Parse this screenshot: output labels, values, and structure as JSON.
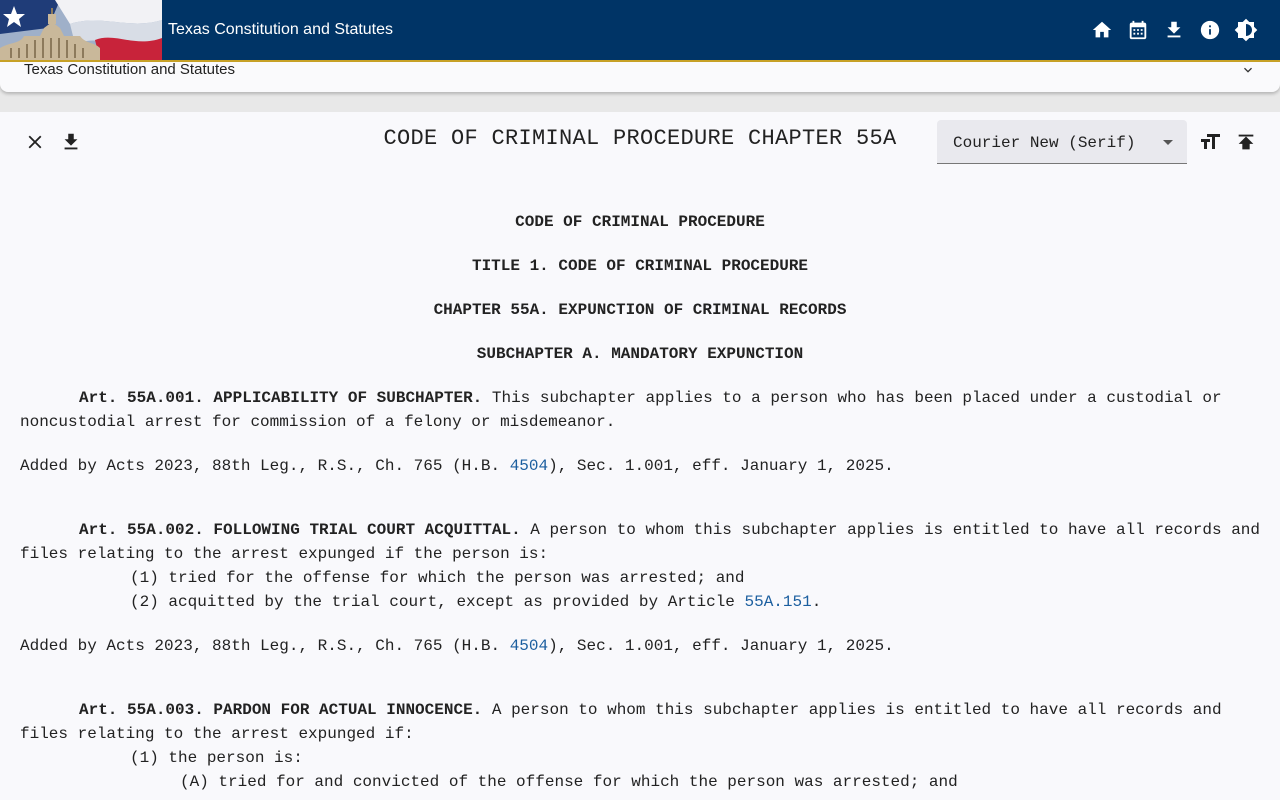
{
  "header": {
    "app_title": "Texas Constitution and Statutes",
    "icons": [
      "home-icon",
      "calendar-icon",
      "download-icon",
      "info-icon",
      "brightness-icon"
    ]
  },
  "panel": {
    "title": "Texas Constitution and Statutes"
  },
  "toolbar": {
    "doc_title": "CODE OF CRIMINAL PROCEDURE CHAPTER 55A",
    "font_select_value": "Courier New (Serif)"
  },
  "document": {
    "headings": [
      "CODE OF CRIMINAL PROCEDURE",
      "TITLE 1. CODE OF CRIMINAL PROCEDURE",
      "CHAPTER 55A.  EXPUNCTION OF CRIMINAL RECORDS",
      "SUBCHAPTER A.  MANDATORY EXPUNCTION"
    ],
    "articles": [
      {
        "heading": "Art. 55A.001.  APPLICABILITY OF SUBCHAPTER.",
        "text": "  This subchapter applies to a person who has been placed under a custodial or noncustodial arrest for commission of a felony or misdemeanor.",
        "source_prefix": "Added by Acts 2023, 88th Leg., R.S., Ch. 765 (H.B. ",
        "source_link": "4504",
        "source_suffix": "), Sec. 1.001, eff. January 1, 2025."
      },
      {
        "heading": "Art. 55A.002.  FOLLOWING TRIAL COURT ACQUITTAL.",
        "text": "  A person to whom this subchapter applies is entitled to have all records and files relating to the arrest expunged if the person is:",
        "items": [
          "(1)  tried for the offense for which the person was arrested; and",
          "(2)  acquitted by the trial court, except as provided by Article "
        ],
        "item_link": "55A.151",
        "item_link_suffix": ".",
        "source_prefix": "Added by Acts 2023, 88th Leg., R.S., Ch. 765 (H.B. ",
        "source_link": "4504",
        "source_suffix": "), Sec. 1.001, eff. January 1, 2025."
      },
      {
        "heading": "Art. 55A.003.  PARDON FOR ACTUAL INNOCENCE.",
        "text": "  A person to whom this subchapter applies is entitled to have all records and files relating to the arrest expunged if:",
        "items": [
          "(1)  the person is:",
          "(A)  tried for and convicted of the offense for which the person was arrested; and"
        ]
      }
    ]
  },
  "colors": {
    "header_bg": "#003466",
    "gold_accent": "#c9a227",
    "link": "#1c5f9f",
    "content_bg": "#f9f9fc"
  }
}
